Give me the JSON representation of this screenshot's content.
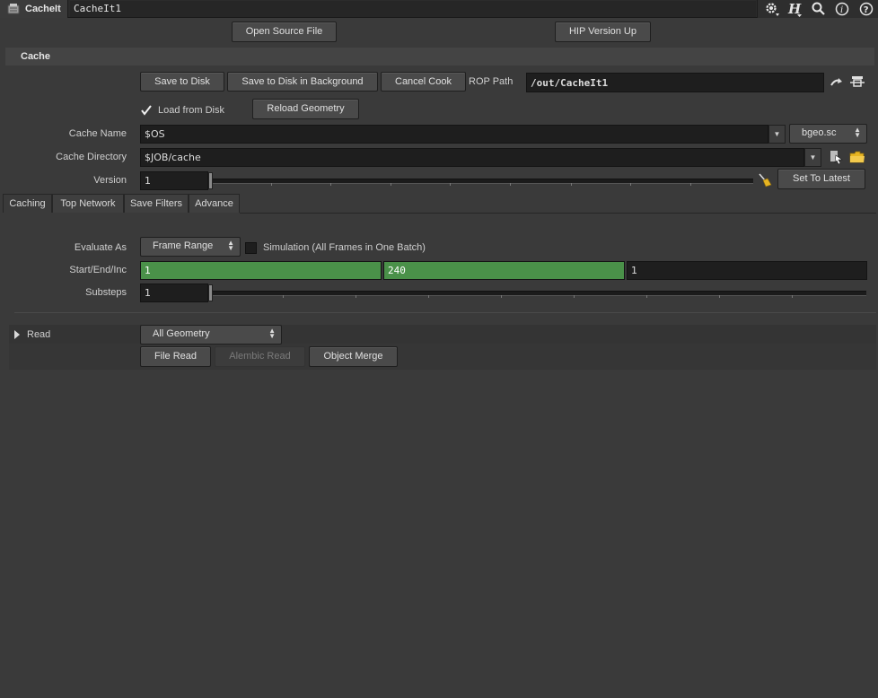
{
  "topbar": {
    "node_type": "CacheIt",
    "node_name": "CacheIt1",
    "icons": [
      "gear-icon",
      "houdini-h-icon",
      "magnifier-icon",
      "info-icon",
      "help-icon"
    ]
  },
  "buttons_top": {
    "open_source": "Open Source File",
    "hip_version_up": "HIP Version Up"
  },
  "section": {
    "title": "Cache"
  },
  "cache": {
    "save_to_disk": "Save to Disk",
    "save_bg": "Save to Disk in Background",
    "cancel_cook": "Cancel Cook",
    "rop_path_label": "ROP Path",
    "rop_path_value": "/out/CacheIt1",
    "load_from_disk_label": "Load from Disk",
    "load_from_disk_checked": true,
    "reload_geometry": "Reload Geometry",
    "cache_name_label": "Cache Name",
    "cache_name_value": "$OS",
    "format_value": "bgeo.sc",
    "cache_dir_label": "Cache Directory",
    "cache_dir_value": "$JOB/cache",
    "version_label": "Version",
    "version_value": "1",
    "set_to_latest": "Set To Latest"
  },
  "tabs": [
    "Caching",
    "Top Network",
    "Save Filters",
    "Advance"
  ],
  "caching": {
    "evaluate_as_label": "Evaluate As",
    "evaluate_as_value": "Frame Range",
    "simulation_label": "Simulation (All Frames in One Batch)",
    "simulation_checked": false,
    "range_label": "Start/End/Inc",
    "start": "1",
    "end": "240",
    "inc": "1",
    "substeps_label": "Substeps",
    "substeps_value": "1"
  },
  "read": {
    "label": "Read",
    "mode_value": "All Geometry",
    "file_read": "File Read",
    "alembic_read": "Alembic Read",
    "object_merge": "Object Merge"
  },
  "colors": {
    "background": "#3a3a3a",
    "field": "#1e1e1e",
    "green_field": "#4a9149",
    "folder_icon": "#e6b422"
  }
}
